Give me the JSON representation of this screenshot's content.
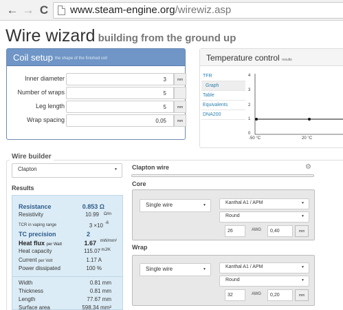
{
  "browser": {
    "back_icon": "←",
    "forward_icon": "→",
    "reload_icon": "C",
    "url_host": "www.steam-engine.org",
    "url_path": "/wirewiz.asp"
  },
  "page": {
    "title": "Wire wizard",
    "subtitle": "building from the ground up"
  },
  "coil_setup": {
    "title": "Coil setup",
    "title_note": "the shape of the finished coil",
    "fields": [
      {
        "label": "Inner diameter",
        "value": "3",
        "unit": "mm"
      },
      {
        "label": "Number of wraps",
        "value": "5",
        "unit": ""
      },
      {
        "label": "Leg length",
        "value": "5",
        "unit": "mm"
      },
      {
        "label": "Wrap spacing",
        "value": "0,05",
        "unit": "mm"
      }
    ]
  },
  "temperature": {
    "title": "Temperature control",
    "title_note": "results",
    "nav": [
      "TFR",
      "Graph",
      "Table",
      "Equivalents",
      "DNA200"
    ],
    "active_nav": "Graph",
    "y_ticks": [
      "4",
      "3",
      "2",
      "1",
      "0"
    ],
    "x_ticks": [
      "-50 °C",
      "20 °C"
    ]
  },
  "wire_builder": {
    "title": "Wire builder",
    "type_select": "Clapton",
    "panel_title": "Clapton wire",
    "gear_icon": "⚙",
    "core": {
      "title": "Core",
      "shape": "Single wire",
      "material": "Kanthal A1 / APM",
      "profile": "Round",
      "gauge": "26",
      "gauge_unit": "AWG",
      "diameter": "0,40",
      "diameter_unit": "mm"
    },
    "wrap": {
      "title": "Wrap",
      "shape": "Single wire",
      "material": "Kanthal A1 / APM",
      "profile": "Round",
      "gauge": "32",
      "gauge_unit": "AWG",
      "diameter": "0,20",
      "diameter_unit": "mm"
    }
  },
  "results": {
    "title": "Results",
    "resistance_label": "Resistance",
    "resistance_value": "0.853 Ω",
    "resistivity_label": "Resistivity",
    "resistivity_value": "10.99",
    "resistivity_unit": "Ω/m",
    "tcr_label": "TCR in vaping range",
    "tcr_value": "3 ×10",
    "tcr_exp": "-6",
    "tc_label": "TC precision",
    "tc_value": "2",
    "heatflux_label": "Heat flux",
    "heatflux_note": "per Watt",
    "heatflux_value": "1.67",
    "heatflux_unit": "mW/mm²",
    "heatcap_label": "Heat capacity",
    "heatcap_value": "115.07",
    "heatcap_unit": "mJ/K",
    "current_label": "Current",
    "current_note": "per Volt",
    "current_value": "1.17 A",
    "power_label": "Power dissipated",
    "power_value": "100 %",
    "width_label": "Width",
    "width_value": "0.81 mm",
    "thickness_label": "Thickness",
    "thickness_value": "0.81 mm",
    "length_label": "Length",
    "length_value": "77.67 mm",
    "surface_label": "Surface area",
    "surface_value": "598.34 mm²"
  }
}
